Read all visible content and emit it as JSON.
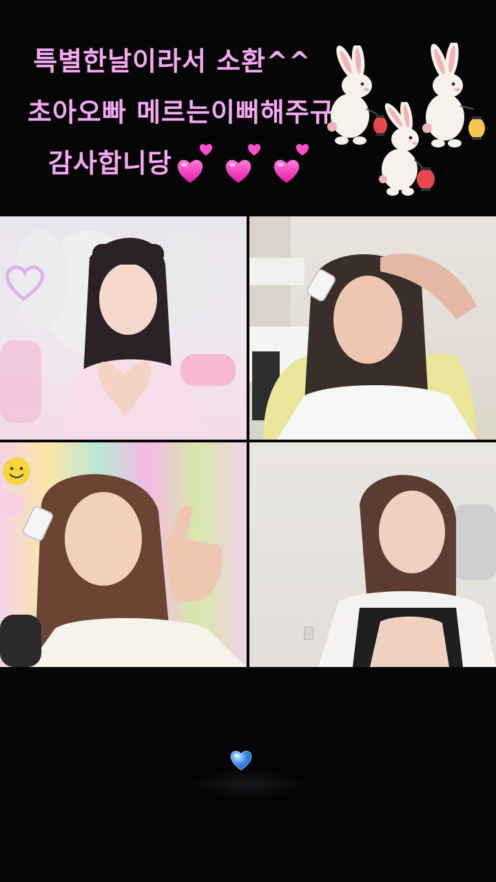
{
  "banner": {
    "line1": "특별한날이라서 소환^^",
    "line2": "초아오빠 메르는이뻐해주규",
    "line3": "감사합니당",
    "hearts": [
      "heart-icon",
      "heart-icon",
      "heart-icon"
    ],
    "text_color": "#f7a8f4",
    "decoration": [
      "bunny-with-lantern-icon",
      "bunny-with-lantern-icon",
      "bunny-with-lantern-icon"
    ]
  },
  "video_tiles": [
    {
      "name": "participant-1",
      "scene": "woman making heart hands, white gaming chair"
    },
    {
      "name": "participant-2",
      "scene": "woman touching her hair, hair clip"
    },
    {
      "name": "participant-3",
      "scene": "woman giving thumbs up, rainbow curtain, smiley balloon"
    },
    {
      "name": "participant-4",
      "scene": "woman in white cardigan, plain wall"
    }
  ],
  "lower": {
    "icon": "blue-heart-icon",
    "accent": "#3b8cf2"
  },
  "colors": {
    "background": "#050505",
    "heart_pink": "#ff3fc6",
    "lantern_red": "#e5484d",
    "lantern_yellow": "#f5c84b"
  }
}
